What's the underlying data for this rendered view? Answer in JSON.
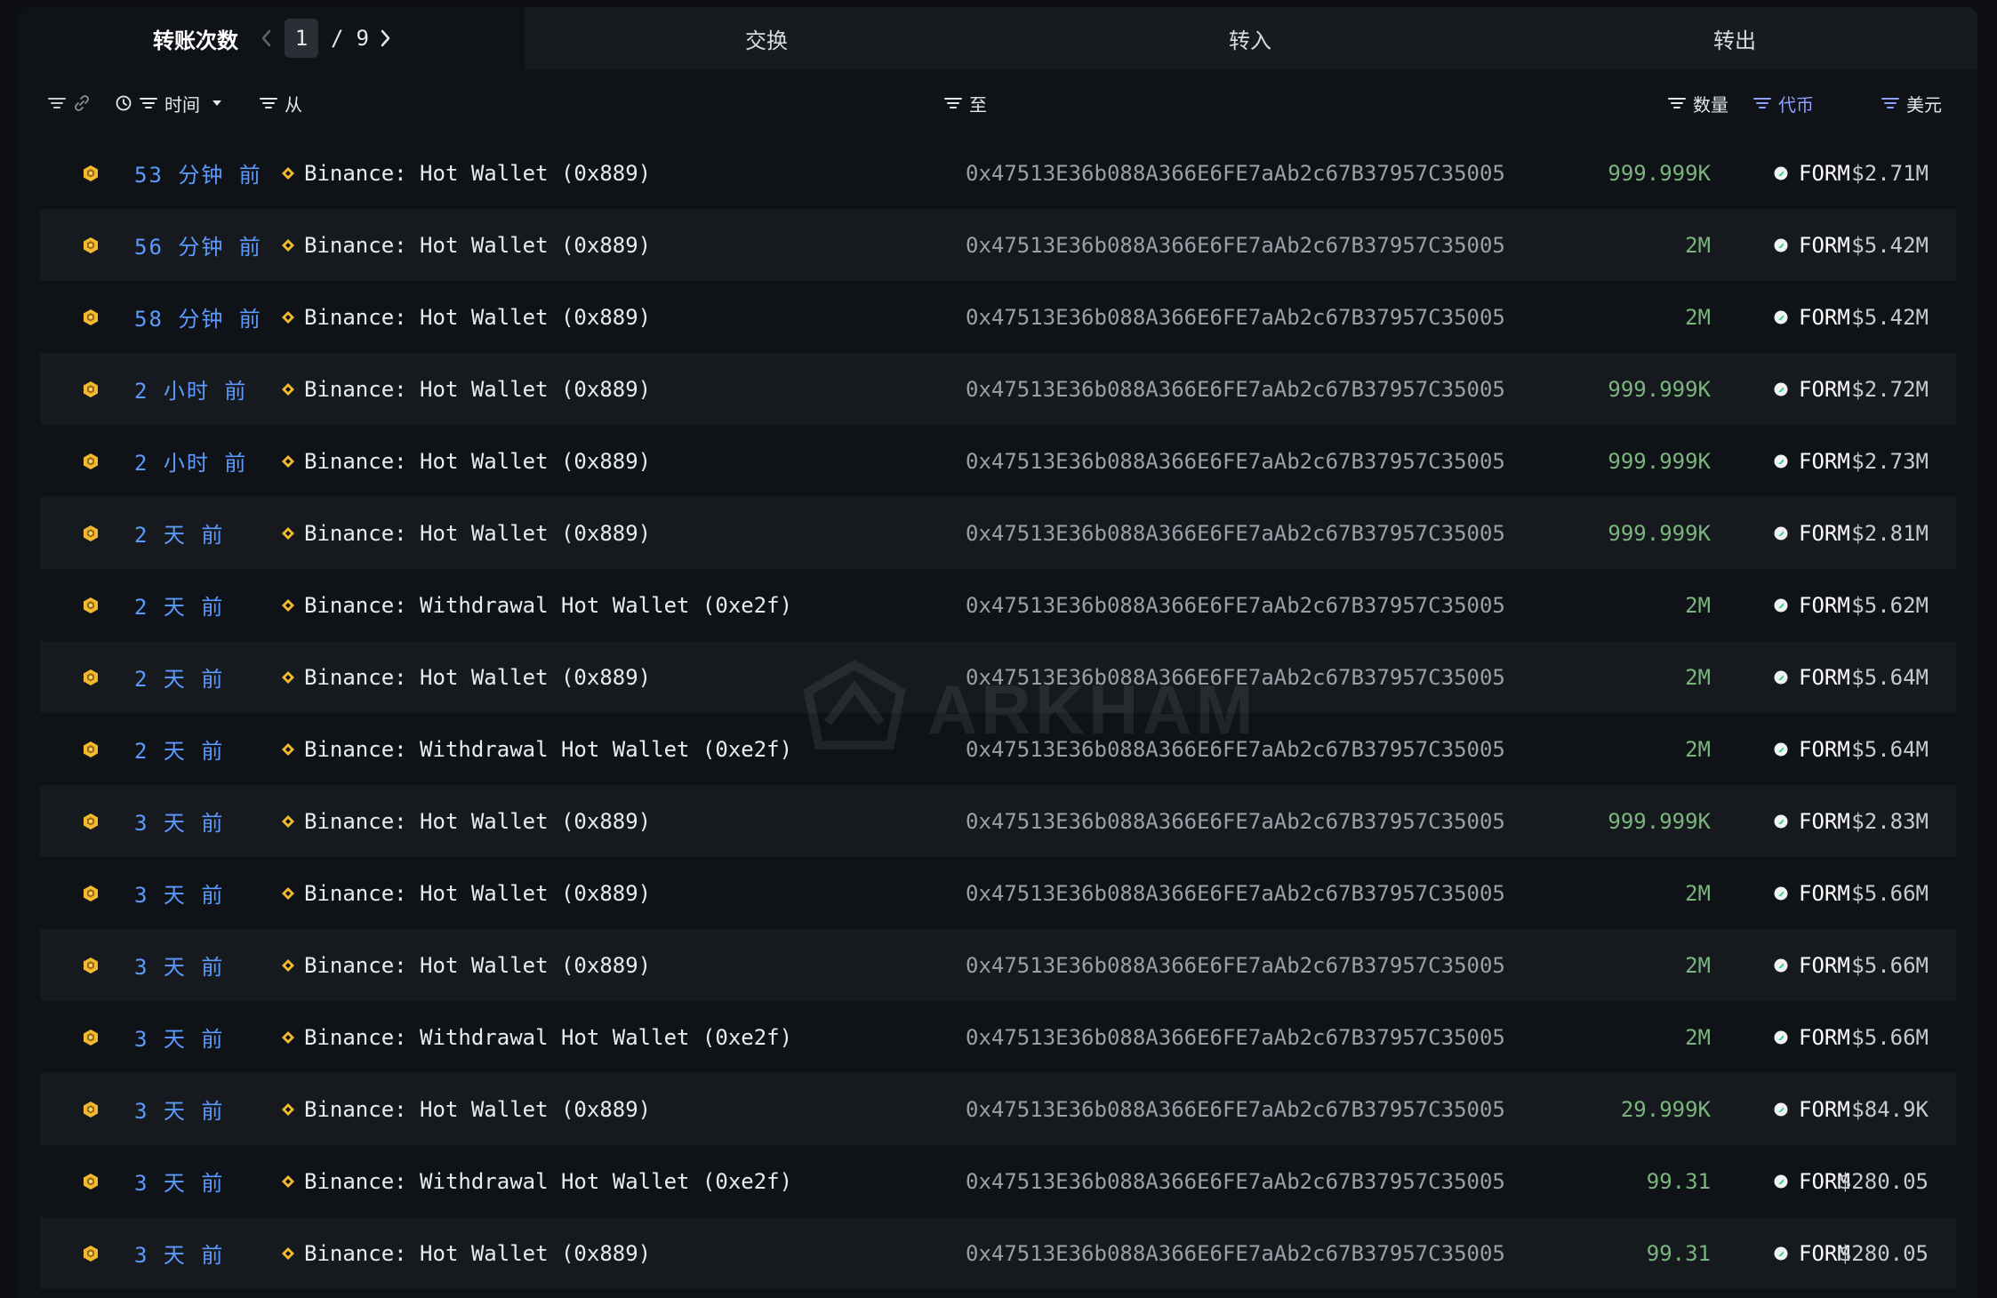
{
  "tabs": {
    "transfers_label": "转账次数",
    "pager": {
      "current": "1",
      "separator": "/",
      "total": "9"
    },
    "swap_label": "交换",
    "inflow_label": "转入",
    "outflow_label": "转出"
  },
  "columns": {
    "time": "时间",
    "from": "从",
    "to": "至",
    "quantity": "数量",
    "token": "代币",
    "usd": "美元"
  },
  "watermark": "ARKHAM",
  "colors": {
    "time_link": "#5b9bff",
    "quantity_green": "#7bb57e",
    "chain_icon": "#f3ba2f",
    "token_icon": "#36d399"
  },
  "rows": [
    {
      "time": "53 分钟 前",
      "from": "Binance: Hot Wallet (0x889)",
      "to": "0x47513E36b088A366E6FE7aAb2c67B37957C35005",
      "qty": "999.999K",
      "token": "FORM",
      "usd": "$2.71M"
    },
    {
      "time": "56 分钟 前",
      "from": "Binance: Hot Wallet (0x889)",
      "to": "0x47513E36b088A366E6FE7aAb2c67B37957C35005",
      "qty": "2M",
      "token": "FORM",
      "usd": "$5.42M"
    },
    {
      "time": "58 分钟 前",
      "from": "Binance: Hot Wallet (0x889)",
      "to": "0x47513E36b088A366E6FE7aAb2c67B37957C35005",
      "qty": "2M",
      "token": "FORM",
      "usd": "$5.42M"
    },
    {
      "time": "2 小时 前",
      "from": "Binance: Hot Wallet (0x889)",
      "to": "0x47513E36b088A366E6FE7aAb2c67B37957C35005",
      "qty": "999.999K",
      "token": "FORM",
      "usd": "$2.72M"
    },
    {
      "time": "2 小时 前",
      "from": "Binance: Hot Wallet (0x889)",
      "to": "0x47513E36b088A366E6FE7aAb2c67B37957C35005",
      "qty": "999.999K",
      "token": "FORM",
      "usd": "$2.73M"
    },
    {
      "time": "2 天 前",
      "from": "Binance: Hot Wallet (0x889)",
      "to": "0x47513E36b088A366E6FE7aAb2c67B37957C35005",
      "qty": "999.999K",
      "token": "FORM",
      "usd": "$2.81M"
    },
    {
      "time": "2 天 前",
      "from": "Binance: Withdrawal Hot Wallet (0xe2f)",
      "to": "0x47513E36b088A366E6FE7aAb2c67B37957C35005",
      "qty": "2M",
      "token": "FORM",
      "usd": "$5.62M"
    },
    {
      "time": "2 天 前",
      "from": "Binance: Hot Wallet (0x889)",
      "to": "0x47513E36b088A366E6FE7aAb2c67B37957C35005",
      "qty": "2M",
      "token": "FORM",
      "usd": "$5.64M"
    },
    {
      "time": "2 天 前",
      "from": "Binance: Withdrawal Hot Wallet (0xe2f)",
      "to": "0x47513E36b088A366E6FE7aAb2c67B37957C35005",
      "qty": "2M",
      "token": "FORM",
      "usd": "$5.64M"
    },
    {
      "time": "3 天 前",
      "from": "Binance: Hot Wallet (0x889)",
      "to": "0x47513E36b088A366E6FE7aAb2c67B37957C35005",
      "qty": "999.999K",
      "token": "FORM",
      "usd": "$2.83M"
    },
    {
      "time": "3 天 前",
      "from": "Binance: Hot Wallet (0x889)",
      "to": "0x47513E36b088A366E6FE7aAb2c67B37957C35005",
      "qty": "2M",
      "token": "FORM",
      "usd": "$5.66M"
    },
    {
      "time": "3 天 前",
      "from": "Binance: Hot Wallet (0x889)",
      "to": "0x47513E36b088A366E6FE7aAb2c67B37957C35005",
      "qty": "2M",
      "token": "FORM",
      "usd": "$5.66M"
    },
    {
      "time": "3 天 前",
      "from": "Binance: Withdrawal Hot Wallet (0xe2f)",
      "to": "0x47513E36b088A366E6FE7aAb2c67B37957C35005",
      "qty": "2M",
      "token": "FORM",
      "usd": "$5.66M"
    },
    {
      "time": "3 天 前",
      "from": "Binance: Hot Wallet (0x889)",
      "to": "0x47513E36b088A366E6FE7aAb2c67B37957C35005",
      "qty": "29.999K",
      "token": "FORM",
      "usd": "$84.9K"
    },
    {
      "time": "3 天 前",
      "from": "Binance: Withdrawal Hot Wallet (0xe2f)",
      "to": "0x47513E36b088A366E6FE7aAb2c67B37957C35005",
      "qty": "99.31",
      "token": "FORM",
      "usd": "$280.05"
    },
    {
      "time": "3 天 前",
      "from": "Binance: Hot Wallet (0x889)",
      "to": "0x47513E36b088A366E6FE7aAb2c67B37957C35005",
      "qty": "99.31",
      "token": "FORM",
      "usd": "$280.05"
    }
  ]
}
